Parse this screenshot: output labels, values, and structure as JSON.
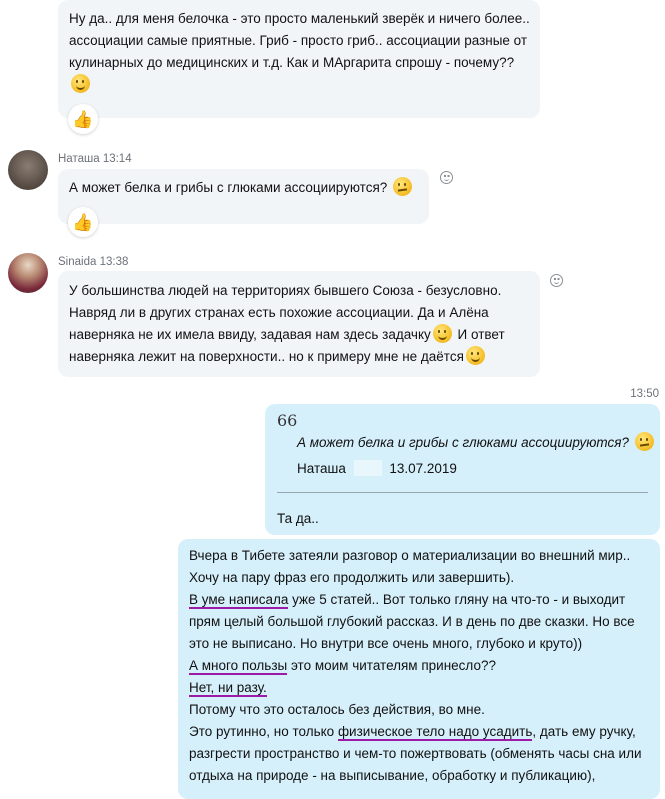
{
  "messages": {
    "m1": {
      "lines": [
        "Ну да.. для меня белочка - это просто маленький зверёк и ничего более..",
        "ассоциации самые приятные. Гриб - просто гриб.. ассоциации разные от",
        "кулинарных до медицинских и т.д. Как и МАргарита спрошу - почему??"
      ],
      "emoji": "smile",
      "reaction_icon": "thumbs-up-icon"
    },
    "m2": {
      "sender": "Наташа",
      "time": "13:14",
      "text": "А может белка и грибы с глюками ассоциируются?",
      "emoji": "thinking",
      "reaction_icon": "thumbs-up-icon"
    },
    "m3": {
      "sender": "Sinaida",
      "time": "13:38",
      "lines": [
        "У большинства людей на территориях бывшего Союза - безусловно.",
        "Навряд ли в других странах есть похожие ассоциации. Да и Алёна",
        "наверняка не их имела ввиду, задавая нам здесь задачку",
        "И ответ",
        "наверняка лежит на поверхности.. но к примеру мне не даётся"
      ]
    },
    "m4": {
      "time": "13:50",
      "quote_mark": "66",
      "quote_text": "А может белка и грибы с глюками ассоциируются?",
      "quote_author": "Наташа",
      "quote_date": "13.07.2019",
      "reply": "Та да.."
    },
    "m5": {
      "l1": "Вчера в Тибете затеяли разговор о материализации во внешний мир..",
      "l2": "Хочу на пару фраз его продолжить или завершить).",
      "l3a": "В уме написала",
      "l3b": " уже 5 статей.. Вот только гляну на что-то - и выходит",
      "l4": "прям целый большой глубокий рассказ. И в день по две сказки. Но все",
      "l5": "это не выписано. Но внутри все очень много, глубоко и круто))",
      "l6a": "А много пользы",
      "l6b": " это моим читателям принесло??",
      "l7": "Нет, ни разу.",
      "l8": "Потому что это осталось без действия, во мне.",
      "l9a": "Это рутинно, но только ",
      "l9b": "физическое тело надо усадить",
      "l9c": ", дать ему ручку,",
      "l10": "разгрести пространство и чем-то пожертвовать (обменять часы сна или",
      "l11": "отдыха на природе - на выписывание, обработку и публикацию),"
    }
  },
  "colors": {
    "incoming_bubble": "#f2f5f8",
    "outgoing_bubble": "#d6f0fb",
    "underline": "#9b1aa6"
  }
}
